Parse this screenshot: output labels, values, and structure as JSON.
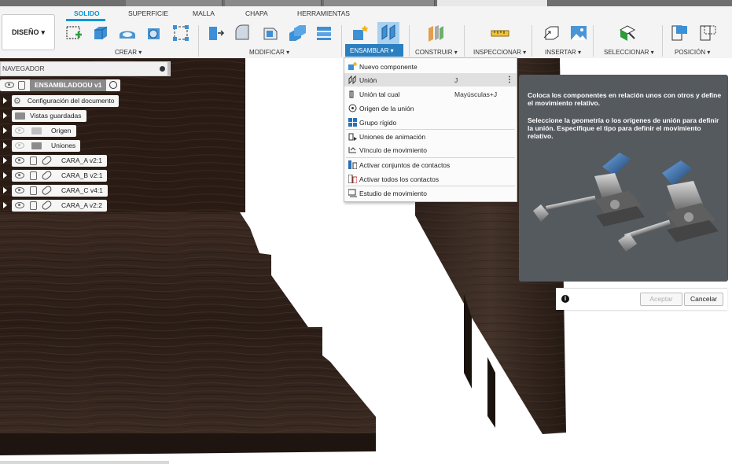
{
  "workspace": {
    "label": "DISEÑO"
  },
  "toolbar_tabs": [
    "SOLIDO",
    "SUPERFICIE",
    "MALLA",
    "CHAPA",
    "HERRAMIENTAS"
  ],
  "toolbar_groups": {
    "crear": "CREAR",
    "modificar": "MODIFICAR",
    "ensamblar": "ENSAMBLAR",
    "construir": "CONSTRUIR",
    "inspeccionar": "INSPECCIONAR",
    "insertar": "INSERTAR",
    "seleccionar": "SELECCIONAR",
    "posicion": "POSICIÓN"
  },
  "navigator": {
    "title": "NAVEGADOR",
    "root": "ENSAMBLADOOU v1",
    "items": [
      {
        "label": "Configuración del documento"
      },
      {
        "label": "Vistas guardadas"
      },
      {
        "label": "Origen"
      },
      {
        "label": "Uniones"
      },
      {
        "label": "CARA_A v2:1"
      },
      {
        "label": "CARA_B v2:1"
      },
      {
        "label": "CARA_C v4:1"
      },
      {
        "label": "CARA_A v2:2"
      }
    ]
  },
  "menu": {
    "items": [
      {
        "label": "Nuevo componente",
        "shortcut": ""
      },
      {
        "label": "Unión",
        "shortcut": "J"
      },
      {
        "label": "Unión tal cual",
        "shortcut": "Mayúsculas+J"
      },
      {
        "label": "Origen de la unión",
        "shortcut": ""
      },
      {
        "label": "Grupo rígido",
        "shortcut": ""
      },
      {
        "label": "Uniones de animación",
        "shortcut": ""
      },
      {
        "label": "Vínculo de movimiento",
        "shortcut": ""
      },
      {
        "label": "Activar conjuntos de contactos",
        "shortcut": ""
      },
      {
        "label": "Activar todos los contactos",
        "shortcut": ""
      },
      {
        "label": "Estudio de movimiento",
        "shortcut": ""
      }
    ]
  },
  "tooltip": {
    "p1": "Coloca los componentes en relación unos con otros y define el movimiento relativo.",
    "p2": "Seleccione la geometría o los orígenes de unión para definir la unión. Especifique el tipo para definir el movimiento relativo."
  },
  "dialog": {
    "accept": "Aceptar",
    "cancel": "Cancelar"
  },
  "colors": {
    "accent": "#0696d7",
    "ensamblar_highlight": "#2a7fc0",
    "tooltip_bg": "#555a5f"
  }
}
